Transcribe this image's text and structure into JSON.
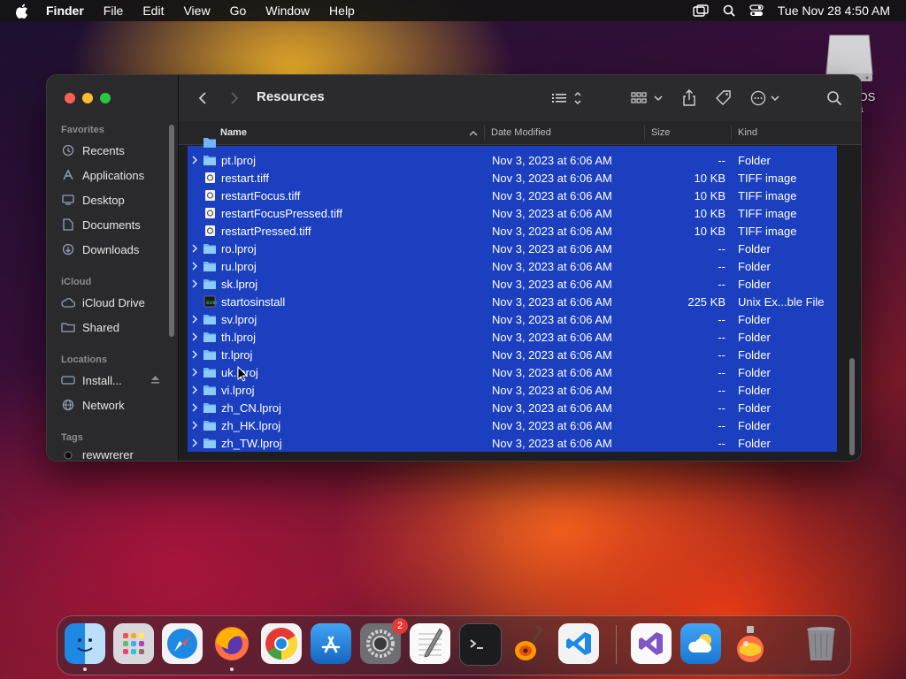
{
  "menubar": {
    "items": [
      "Finder",
      "File",
      "Edit",
      "View",
      "Go",
      "Window",
      "Help"
    ],
    "clock": "Tue Nov 28  4:50 AM"
  },
  "desktop": {
    "disk_label": "cOS\nra"
  },
  "window": {
    "title": "Resources",
    "sidebar": {
      "favorites_title": "Favorites",
      "favorites": [
        "Recents",
        "Applications",
        "Desktop",
        "Documents",
        "Downloads"
      ],
      "icloud_title": "iCloud",
      "icloud": [
        "iCloud Drive",
        "Shared"
      ],
      "locations_title": "Locations",
      "locations": [
        "Install...",
        "Network"
      ],
      "tags_title": "Tags",
      "tags": [
        "rewwrerer"
      ]
    },
    "columns": {
      "name": "Name",
      "date": "Date Modified",
      "size": "Size",
      "kind": "Kind"
    },
    "rows": [
      {
        "name": "pt.lproj",
        "date": "Nov 3, 2023 at 6:06 AM",
        "size": "--",
        "kind": "Folder",
        "type": "folder"
      },
      {
        "name": "restart.tiff",
        "date": "Nov 3, 2023 at 6:06 AM",
        "size": "10 KB",
        "kind": "TIFF image",
        "type": "image"
      },
      {
        "name": "restartFocus.tiff",
        "date": "Nov 3, 2023 at 6:06 AM",
        "size": "10 KB",
        "kind": "TIFF image",
        "type": "image"
      },
      {
        "name": "restartFocusPressed.tiff",
        "date": "Nov 3, 2023 at 6:06 AM",
        "size": "10 KB",
        "kind": "TIFF image",
        "type": "image"
      },
      {
        "name": "restartPressed.tiff",
        "date": "Nov 3, 2023 at 6:06 AM",
        "size": "10 KB",
        "kind": "TIFF image",
        "type": "image"
      },
      {
        "name": "ro.lproj",
        "date": "Nov 3, 2023 at 6:06 AM",
        "size": "--",
        "kind": "Folder",
        "type": "folder"
      },
      {
        "name": "ru.lproj",
        "date": "Nov 3, 2023 at 6:06 AM",
        "size": "--",
        "kind": "Folder",
        "type": "folder"
      },
      {
        "name": "sk.lproj",
        "date": "Nov 3, 2023 at 6:06 AM",
        "size": "--",
        "kind": "Folder",
        "type": "folder"
      },
      {
        "name": "startosinstall",
        "date": "Nov 3, 2023 at 6:06 AM",
        "size": "225 KB",
        "kind": "Unix Ex...ble File",
        "type": "exec"
      },
      {
        "name": "sv.lproj",
        "date": "Nov 3, 2023 at 6:06 AM",
        "size": "--",
        "kind": "Folder",
        "type": "folder"
      },
      {
        "name": "th.lproj",
        "date": "Nov 3, 2023 at 6:06 AM",
        "size": "--",
        "kind": "Folder",
        "type": "folder"
      },
      {
        "name": "tr.lproj",
        "date": "Nov 3, 2023 at 6:06 AM",
        "size": "--",
        "kind": "Folder",
        "type": "folder"
      },
      {
        "name": "uk.lproj",
        "date": "Nov 3, 2023 at 6:06 AM",
        "size": "--",
        "kind": "Folder",
        "type": "folder"
      },
      {
        "name": "vi.lproj",
        "date": "Nov 3, 2023 at 6:06 AM",
        "size": "--",
        "kind": "Folder",
        "type": "folder"
      },
      {
        "name": "zh_CN.lproj",
        "date": "Nov 3, 2023 at 6:06 AM",
        "size": "--",
        "kind": "Folder",
        "type": "folder"
      },
      {
        "name": "zh_HK.lproj",
        "date": "Nov 3, 2023 at 6:06 AM",
        "size": "--",
        "kind": "Folder",
        "type": "folder"
      },
      {
        "name": "zh_TW.lproj",
        "date": "Nov 3, 2023 at 6:06 AM",
        "size": "--",
        "kind": "Folder",
        "type": "folder"
      }
    ]
  },
  "dock": {
    "apps": [
      "finder-icon",
      "launchpad-icon",
      "safari-icon",
      "firefox-icon",
      "chrome-icon",
      "app-store-icon",
      "system-settings-icon",
      "textedit-icon",
      "terminal-icon",
      "garageband-icon",
      "vscode-icon",
      "visual-studio-icon",
      "weather-icon",
      "installer-icon",
      "trash-icon"
    ],
    "settings_badge": "2"
  },
  "colors": {
    "selection": "#1b3fbf",
    "accent": "#2f6fed"
  }
}
